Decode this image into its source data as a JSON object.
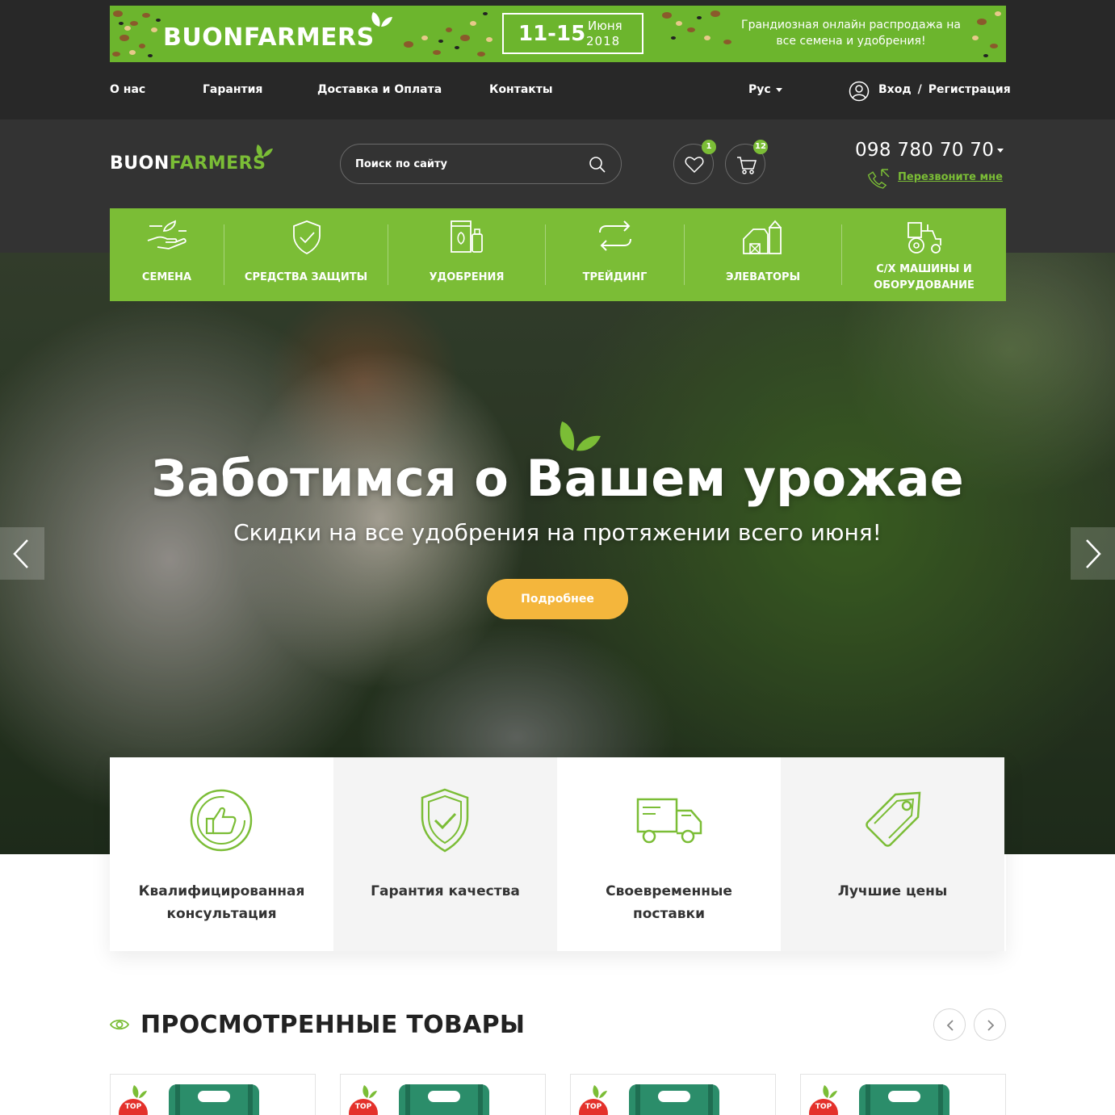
{
  "banner": {
    "brand": "BUONFARMERS",
    "days": "11-15",
    "month": "Июня",
    "year": "2018",
    "text": "Грандиозная онлайн распродажа на все семена и удобрения!"
  },
  "topnav": {
    "items": [
      {
        "label": "О нас"
      },
      {
        "label": "Гарантия"
      },
      {
        "label": "Доставка и Оплата"
      },
      {
        "label": "Контакты"
      }
    ],
    "language": "Рус",
    "login": "Вход",
    "separator": "/",
    "register": "Регистрация"
  },
  "header": {
    "logo_white": "BUON",
    "logo_green": "FARMERS",
    "search_placeholder": "Поиск по сайту",
    "wishlist_count": "1",
    "cart_count": "12",
    "phone": "098 780 70 70",
    "callback": "Перезвоните мне"
  },
  "categories": [
    {
      "label": "СЕМЕНА",
      "icon": "hand-seed-icon"
    },
    {
      "label": "СРЕДСТВА ЗАЩИТЫ",
      "icon": "shield-check-icon"
    },
    {
      "label": "УДОБРЕНИЯ",
      "icon": "fertilizer-icon"
    },
    {
      "label": "ТРЕЙДИНГ",
      "icon": "exchange-arrows-icon"
    },
    {
      "label": "ЭЛЕВАТОРЫ",
      "icon": "elevator-icon"
    },
    {
      "label": "С/Х МАШИНЫ И ОБОРУДОВАНИЕ",
      "icon": "tractor-icon"
    }
  ],
  "hero": {
    "title": "Заботимся о Вашем урожае",
    "subtitle": "Скидки на все удобрения на протяжении всего июня!",
    "button": "Подробнее"
  },
  "features": [
    {
      "label": "Квалифицированная консультация",
      "icon": "thumbs-up-icon"
    },
    {
      "label": "Гарантия качества",
      "icon": "shield-check-icon"
    },
    {
      "label": "Своевременные поставки",
      "icon": "truck-icon"
    },
    {
      "label": "Лучшие цены",
      "icon": "price-tag-icon"
    }
  ],
  "viewed": {
    "title": "ПРОСМОТРЕННЫЕ ТОВАРЫ",
    "badge": "TOP"
  },
  "colors": {
    "accent_green": "#7bbd36",
    "dark_bg": "#282828",
    "header_bg": "#333333",
    "button_orange": "#f4b63c",
    "top_badge_red": "#e4312b"
  }
}
